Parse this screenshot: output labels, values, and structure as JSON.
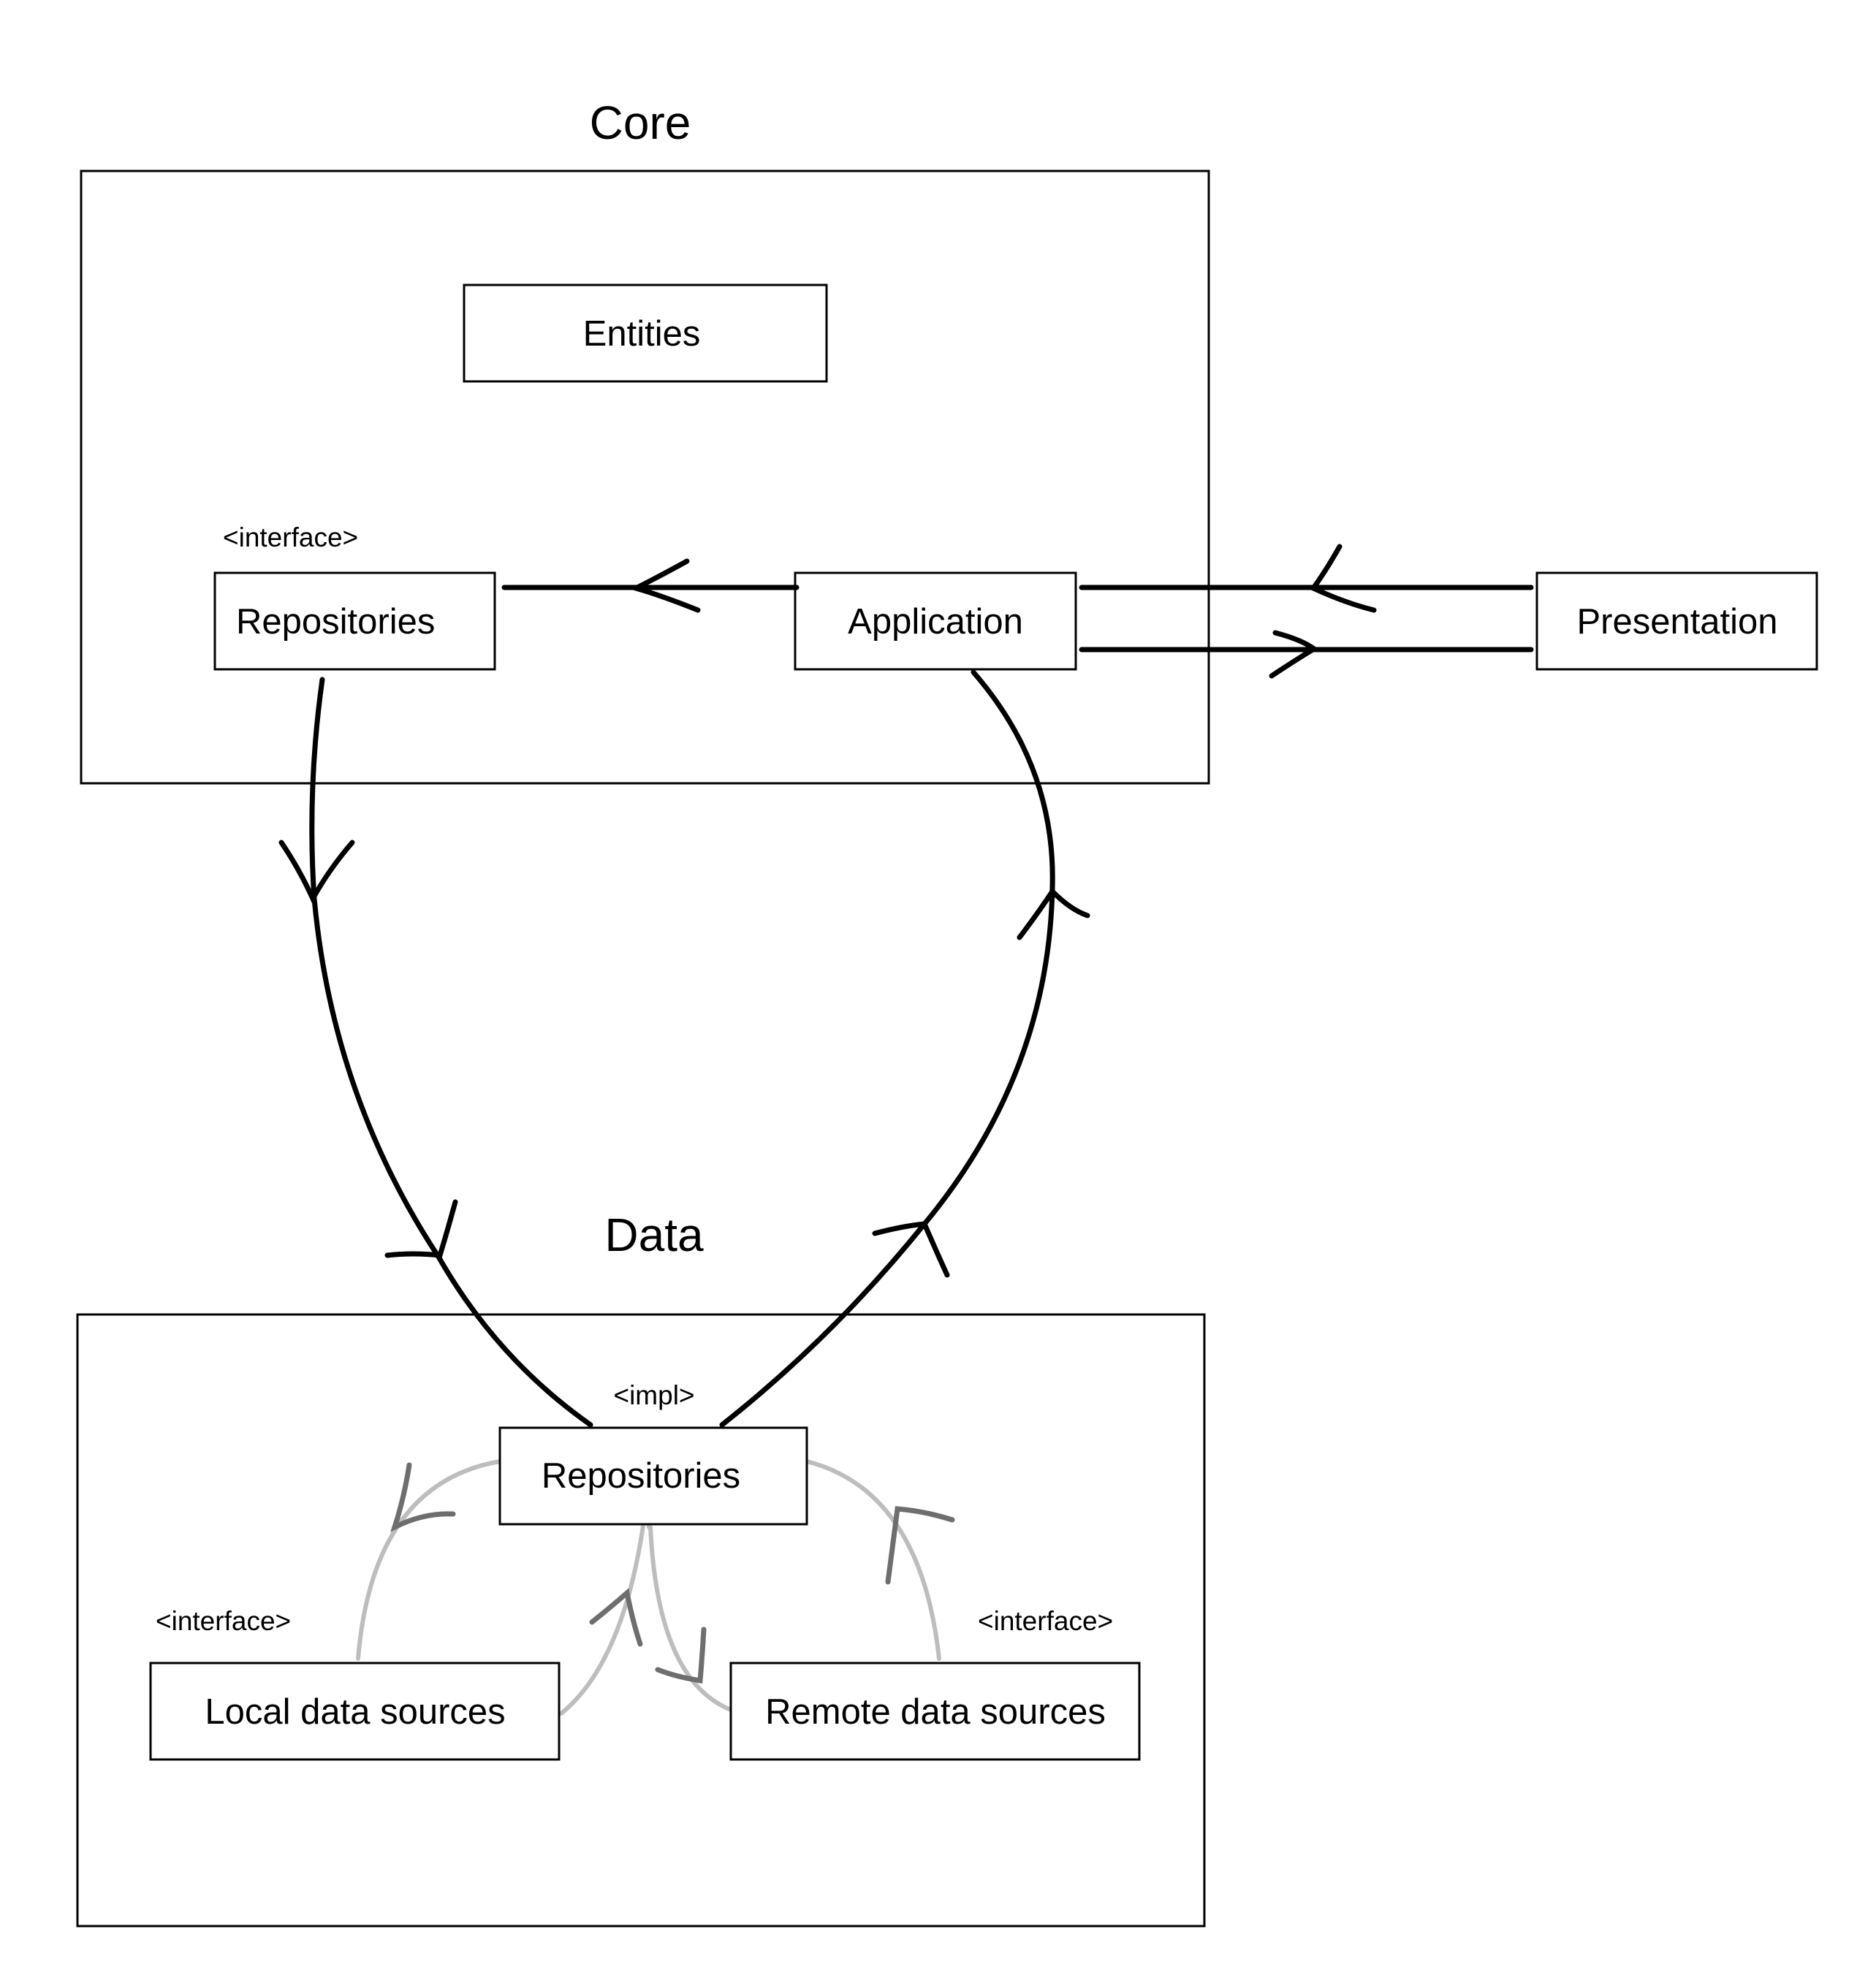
{
  "core": {
    "title": "Core",
    "entities": "Entities",
    "repositories_stereotype": "<interface>",
    "repositories": "Repositories",
    "application": "Application"
  },
  "presentation": "Presentation",
  "data": {
    "title": "Data",
    "repositories_stereotype": "<impl>",
    "repositories": "Repositories",
    "local_stereotype": "<interface>",
    "local": "Local data sources",
    "remote_stereotype": "<interface>",
    "remote": "Remote data sources"
  },
  "colors": {
    "primary_stroke": "#000000",
    "secondary_line": "#bdbdbd",
    "secondary_arrow": "#6e6e6e"
  }
}
